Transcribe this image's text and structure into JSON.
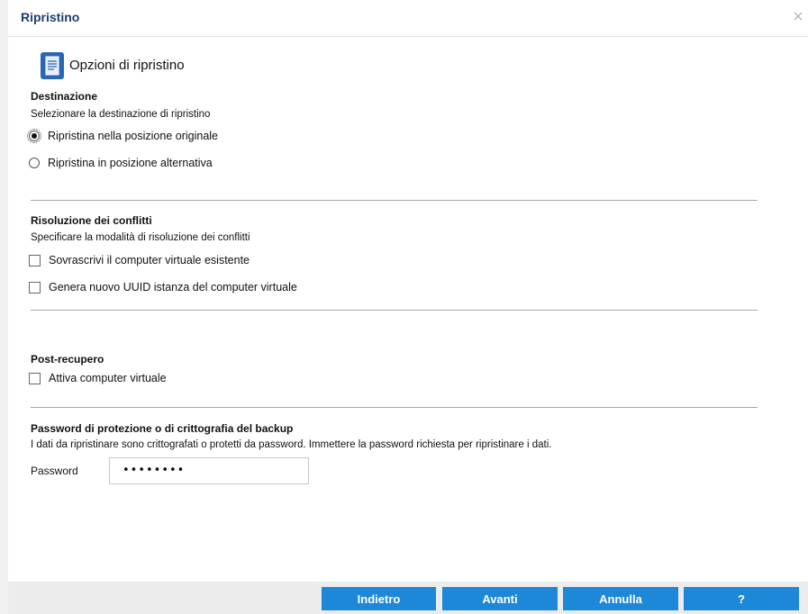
{
  "dialog": {
    "title": "Ripristino"
  },
  "header": {
    "title": "Opzioni di ripristino",
    "icon": "document-icon"
  },
  "destination": {
    "title": "Destinazione",
    "description": "Selezionare la destinazione di ripristino",
    "options": [
      {
        "label": "Ripristina nella posizione originale",
        "selected": true
      },
      {
        "label": "Ripristina in posizione alternativa",
        "selected": false
      }
    ]
  },
  "conflicts": {
    "title": "Risoluzione dei conflitti",
    "description": "Specificare la modalità di risoluzione dei conflitti",
    "options": [
      {
        "label": "Sovrascrivi il computer virtuale esistente",
        "checked": false
      },
      {
        "label": "Genera nuovo UUID istanza del computer virtuale",
        "checked": false
      }
    ]
  },
  "post_recovery": {
    "title": "Post-recupero",
    "options": [
      {
        "label": "Attiva computer virtuale",
        "checked": false
      }
    ]
  },
  "password_section": {
    "title": "Password di protezione o di crittografia del backup",
    "description": "I dati da ripristinare sono crittografati o protetti da password. Immettere la password richiesta per ripristinare i dati.",
    "label": "Password",
    "value": "••••••••"
  },
  "buttons": {
    "back": "Indietro",
    "next": "Avanti",
    "cancel": "Annulla",
    "help": "?"
  },
  "colors": {
    "title": "#1a3d73",
    "button": "#1e88d8"
  }
}
